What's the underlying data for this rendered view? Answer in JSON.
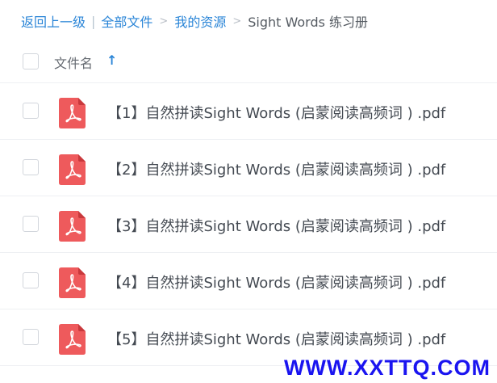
{
  "breadcrumb": {
    "back": "返回上一级",
    "all_files": "全部文件",
    "my_resources": "我的资源",
    "current": "Sight Words 练习册",
    "separator": ">"
  },
  "header": {
    "column_title": "文件名",
    "sort_arrow": "↑"
  },
  "files": [
    {
      "name": "【1】自然拼读Sight Words (启蒙阅读高频词 ) .pdf",
      "icon": "pdf-icon"
    },
    {
      "name": "【2】自然拼读Sight Words (启蒙阅读高频词 ) .pdf",
      "icon": "pdf-icon"
    },
    {
      "name": "【3】自然拼读Sight Words (启蒙阅读高频词 ) .pdf",
      "icon": "pdf-icon"
    },
    {
      "name": "【4】自然拼读Sight Words (启蒙阅读高频词 ) .pdf",
      "icon": "pdf-icon"
    },
    {
      "name": "【5】自然拼读Sight Words (启蒙阅读高频词 ) .pdf",
      "icon": "pdf-icon"
    }
  ],
  "watermark": "WWW.XXTTQ.COM",
  "colors": {
    "link": "#2a85d7",
    "pdf_red": "#ee5a5c",
    "watermark": "#1a14f0"
  }
}
